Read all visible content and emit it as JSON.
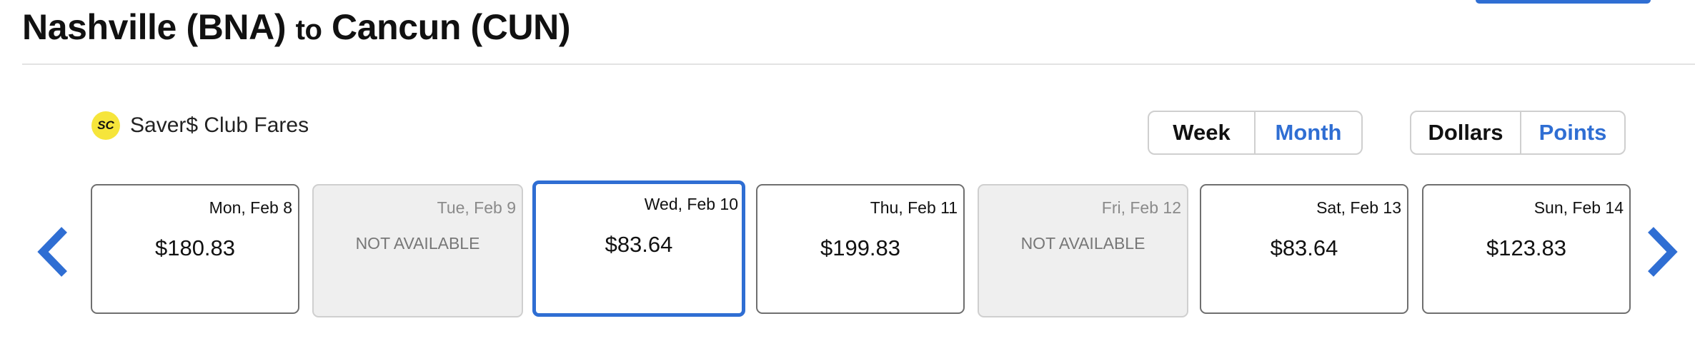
{
  "header": {
    "origin": "Nashville (BNA)",
    "connector": "to",
    "destination": "Cancun (CUN)"
  },
  "saver_club": {
    "badge": "SC",
    "label": "Saver$ Club Fares"
  },
  "view_toggle": {
    "week_label": "Week",
    "month_label": "Month",
    "selected": "Week"
  },
  "currency_toggle": {
    "dollars_label": "Dollars",
    "points_label": "Points",
    "selected": "Dollars"
  },
  "navigation": {
    "prev_icon": "chevron-left-icon",
    "next_icon": "chevron-right-icon"
  },
  "days": [
    {
      "date": "Mon, Feb 8",
      "price": "$180.83",
      "available": true
    },
    {
      "date": "Tue, Feb 9",
      "status": "NOT AVAILABLE",
      "available": false
    },
    {
      "date": "Wed, Feb 10",
      "price": "$83.64",
      "available": true,
      "selected": true
    },
    {
      "date": "Thu, Feb 11",
      "price": "$199.83",
      "available": true
    },
    {
      "date": "Fri, Feb 12",
      "status": "NOT AVAILABLE",
      "available": false
    },
    {
      "date": "Sat, Feb 13",
      "price": "$83.64",
      "available": true
    },
    {
      "date": "Sun, Feb 14",
      "price": "$123.83",
      "available": true
    }
  ],
  "colors": {
    "accent": "#2f6ed3",
    "badge": "#f6e53b",
    "unavailable_bg": "#efefef"
  }
}
